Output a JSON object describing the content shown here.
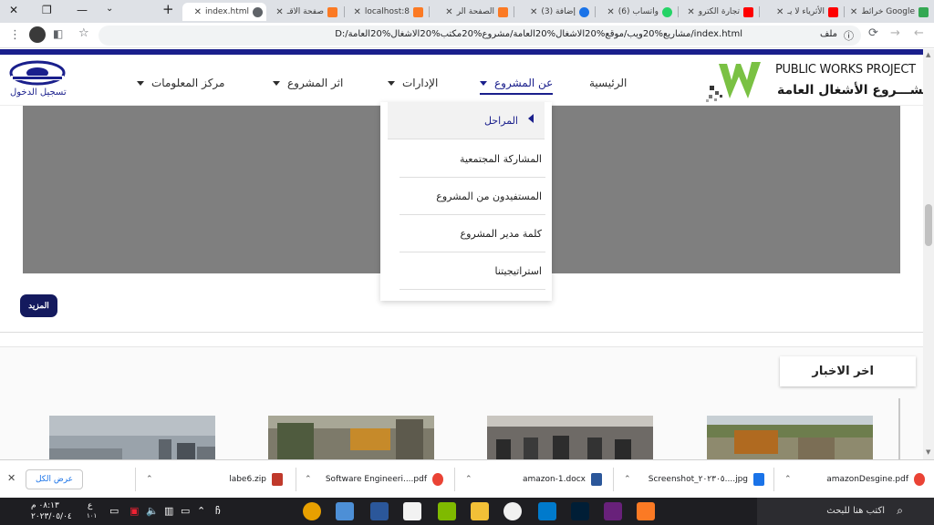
{
  "browser": {
    "tabs": [
      {
        "title": "خرائط Google",
        "favicon_color": "#34a853"
      },
      {
        "title": "الأثرياء لا يـ",
        "favicon_color": "#ff0000"
      },
      {
        "title": "تجارة الكترو",
        "favicon_color": "#ff0000"
      },
      {
        "title": "(6) واتساب",
        "favicon_color": "#25d366"
      },
      {
        "title": "(3) إضافة",
        "favicon_color": "#1a73e8"
      },
      {
        "title": "الصفحة الر",
        "favicon_color": "#fb7a24"
      },
      {
        "title": "localhost:8",
        "favicon_color": "#fb7a24"
      },
      {
        "title": "صفحة الاقـ",
        "favicon_color": "#fb7a24"
      },
      {
        "title": "index.html",
        "favicon_color": "#5f6368",
        "active": true
      }
    ],
    "new_tab": "+",
    "address": {
      "file_label": "ملف",
      "url": "D:/مشاريع%20ويب/موقع%20الاشغال%20العامة/مشروع%20مكتب%20الاشغال%20العامة/index.html"
    }
  },
  "site": {
    "logo": {
      "title": "PUBLIC WORKS PROJECT",
      "subtitle": "مشـــروع الأشغال العامة"
    },
    "nav": {
      "home": "الرئيسية",
      "about": "عن المشروع",
      "departments": "الإدارات",
      "impact": "اثر المشروع",
      "info_center": "مركز المعلومات",
      "login": "تسجيل الدخول"
    },
    "dropdown": {
      "items": [
        "المراحل",
        "المشاركة المجتمعية",
        "المستفيدون من المشروع",
        "كلمة مدير المشروع",
        "استراتيجيتنا"
      ]
    },
    "more_button": "المزيد",
    "news_title": "اخر الاخبار"
  },
  "downloads": {
    "show_all": "عرض الكل",
    "items": [
      {
        "name": "amazonDesgine.pdf",
        "icon_color": "#ea4335"
      },
      {
        "name": "Screenshot_٢٠٢٣٠٥....jpg",
        "icon_color": "#1a73e8"
      },
      {
        "name": "amazon-1.docx",
        "icon_color": "#2b579a"
      },
      {
        "name": "Software Engineeri....pdf",
        "icon_color": "#ea4335"
      },
      {
        "name": "labe6.zip",
        "icon_color": "#c0392b"
      }
    ]
  },
  "taskbar": {
    "search_placeholder": "اكتب هنا للبحث",
    "time": "٠٨:١٣ م",
    "date": "٢٠٢٣/٠٥/٠٤",
    "lang": "ع",
    "lang_sub": "١٠١"
  },
  "colors": {
    "brand": "#1a1f8c",
    "logo_green": "#7ac143",
    "hero_gray": "#7f7f7f"
  }
}
